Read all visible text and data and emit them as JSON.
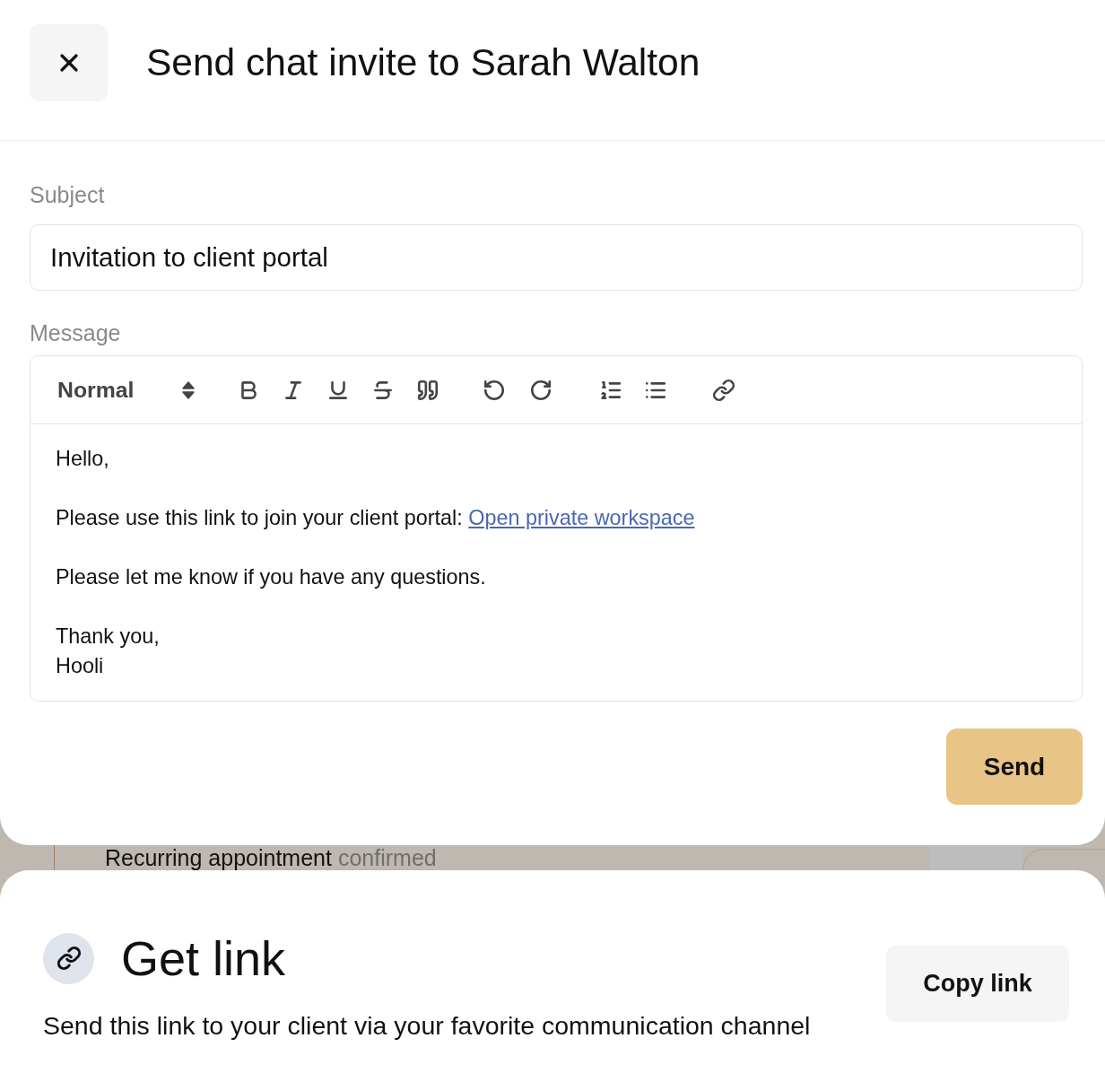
{
  "header": {
    "title": "Send chat invite to Sarah Walton"
  },
  "subject": {
    "label": "Subject",
    "value": "Invitation to client portal"
  },
  "message": {
    "label": "Message",
    "format": "Normal",
    "paragraphs": [
      [
        {
          "text": "Hello,"
        }
      ],
      [
        {
          "text": "Please use this link to join your client portal:",
          "link": "Open private workspace"
        }
      ],
      [
        {
          "text": "Please let me know if you have any questions."
        }
      ],
      [
        {
          "text": "Thank you,"
        },
        {
          "text": "Hooli"
        }
      ]
    ]
  },
  "send_button": "Send",
  "background_row": {
    "title": "Recurring appointment",
    "status": "confirmed"
  },
  "get_link": {
    "title": "Get link",
    "description": "Send this link to your client via your favorite communication channel",
    "button": "Copy link"
  }
}
